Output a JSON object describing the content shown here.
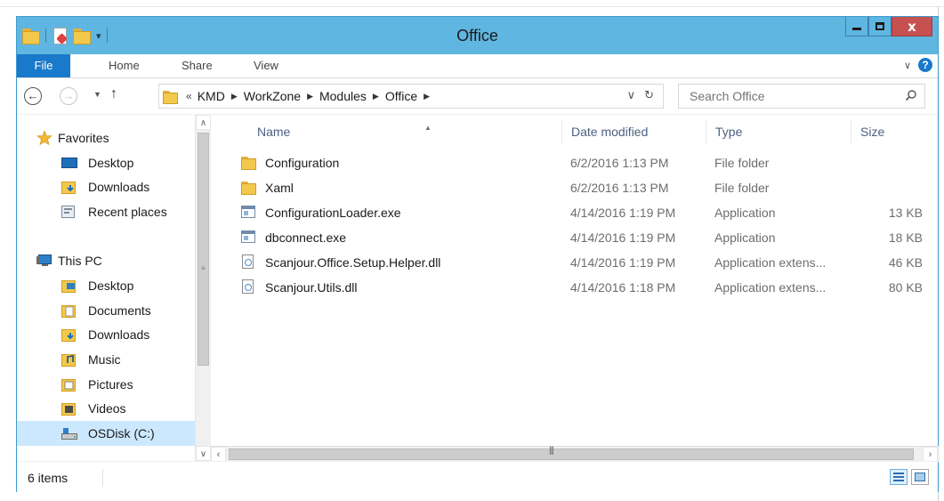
{
  "window": {
    "title": "Office",
    "controls": {
      "minimize": "minimize",
      "maximize": "maximize",
      "close": "x"
    }
  },
  "ribbon": {
    "tabs": [
      {
        "label": "File",
        "active": true
      },
      {
        "label": "Home"
      },
      {
        "label": "Share"
      },
      {
        "label": "View"
      }
    ],
    "help_label": "?"
  },
  "navbar": {
    "back_label": "←",
    "forward_label": "→",
    "up_label": "↑",
    "breadcrumb_prefix": "«",
    "breadcrumbs": [
      "KMD",
      "WorkZone",
      "Modules",
      "Office"
    ],
    "search_placeholder": "Search Office"
  },
  "nav_pane": {
    "items": [
      {
        "label": "Favorites",
        "icon": "star-icon",
        "level": 0
      },
      {
        "label": "Desktop",
        "icon": "desktop-icon",
        "level": 1
      },
      {
        "label": "Downloads",
        "icon": "downloads-folder-icon",
        "level": 1
      },
      {
        "label": "Recent places",
        "icon": "recent-places-icon",
        "level": 1
      },
      {
        "label": "",
        "icon": "",
        "level": 0
      },
      {
        "label": "This PC",
        "icon": "computer-icon",
        "level": 0
      },
      {
        "label": "Desktop",
        "icon": "desktop-folder-icon",
        "level": 1
      },
      {
        "label": "Documents",
        "icon": "documents-folder-icon",
        "level": 1
      },
      {
        "label": "Downloads",
        "icon": "downloads-folder-icon",
        "level": 1
      },
      {
        "label": "Music",
        "icon": "music-folder-icon",
        "level": 1
      },
      {
        "label": "Pictures",
        "icon": "pictures-folder-icon",
        "level": 1
      },
      {
        "label": "Videos",
        "icon": "videos-folder-icon",
        "level": 1
      },
      {
        "label": "OSDisk (C:)",
        "icon": "drive-icon",
        "level": 1,
        "selected": true
      }
    ]
  },
  "file_list": {
    "columns": [
      "Name",
      "Date modified",
      "Type",
      "Size"
    ],
    "rows": [
      {
        "name": "Configuration",
        "date": "6/2/2016 1:13 PM",
        "type": "File folder",
        "size": "",
        "icon": "folder-icon"
      },
      {
        "name": "Xaml",
        "date": "6/2/2016 1:13 PM",
        "type": "File folder",
        "size": "",
        "icon": "folder-icon"
      },
      {
        "name": "ConfigurationLoader.exe",
        "date": "4/14/2016 1:19 PM",
        "type": "Application",
        "size": "13 KB",
        "icon": "exe-icon"
      },
      {
        "name": "dbconnect.exe",
        "date": "4/14/2016 1:19 PM",
        "type": "Application",
        "size": "18 KB",
        "icon": "exe-icon"
      },
      {
        "name": "Scanjour.Office.Setup.Helper.dll",
        "date": "4/14/2016 1:19 PM",
        "type": "Application extens...",
        "size": "46 KB",
        "icon": "dll-icon"
      },
      {
        "name": "Scanjour.Utils.dll",
        "date": "4/14/2016 1:18 PM",
        "type": "Application extens...",
        "size": "80 KB",
        "icon": "dll-icon"
      }
    ]
  },
  "status_bar": {
    "item_count": "6 items"
  },
  "colors": {
    "title_bar": "#5fb6e0",
    "file_tab": "#1979ca",
    "close_button": "#c75050",
    "selection": "#cce8ff",
    "header_text": "#4d6082"
  }
}
